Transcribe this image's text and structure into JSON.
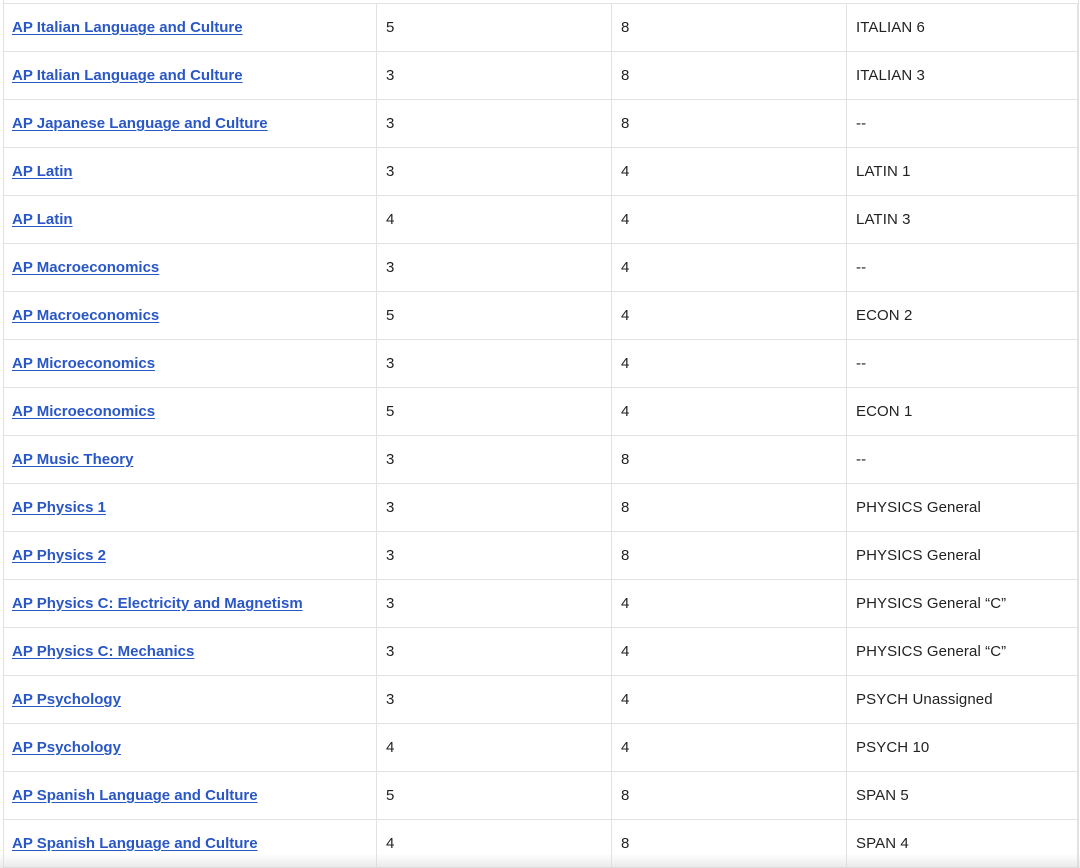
{
  "table": {
    "rows": [
      {
        "exam": "AP Italian Language and Culture",
        "score": "5",
        "units": "8",
        "equivalent": "ITALIAN 6"
      },
      {
        "exam": "AP Italian Language and Culture",
        "score": "3",
        "units": "8",
        "equivalent": "ITALIAN 3"
      },
      {
        "exam": "AP Japanese Language and Culture",
        "score": "3",
        "units": "8",
        "equivalent": "--"
      },
      {
        "exam": "AP Latin",
        "score": "3",
        "units": "4",
        "equivalent": "LATIN 1"
      },
      {
        "exam": "AP Latin",
        "score": "4",
        "units": "4",
        "equivalent": "LATIN 3"
      },
      {
        "exam": "AP Macroeconomics",
        "score": "3",
        "units": "4",
        "equivalent": "--"
      },
      {
        "exam": "AP Macroeconomics",
        "score": "5",
        "units": "4",
        "equivalent": "ECON 2"
      },
      {
        "exam": "AP Microeconomics",
        "score": "3",
        "units": "4",
        "equivalent": "--"
      },
      {
        "exam": "AP Microeconomics",
        "score": "5",
        "units": "4",
        "equivalent": "ECON 1"
      },
      {
        "exam": "AP Music Theory",
        "score": "3",
        "units": "8",
        "equivalent": "--"
      },
      {
        "exam": "AP Physics 1",
        "score": "3",
        "units": "8",
        "equivalent": "PHYSICS General"
      },
      {
        "exam": "AP Physics 2",
        "score": "3",
        "units": "8",
        "equivalent": "PHYSICS General"
      },
      {
        "exam": "AP Physics C: Electricity and Magnetism",
        "score": "3",
        "units": "4",
        "equivalent": "PHYSICS General “C”"
      },
      {
        "exam": "AP Physics C: Mechanics",
        "score": "3",
        "units": "4",
        "equivalent": "PHYSICS General “C”"
      },
      {
        "exam": "AP Psychology",
        "score": "3",
        "units": "4",
        "equivalent": "PSYCH Unassigned"
      },
      {
        "exam": "AP Psychology",
        "score": "4",
        "units": "4",
        "equivalent": "PSYCH 10"
      },
      {
        "exam": "AP Spanish Language and Culture",
        "score": "5",
        "units": "8",
        "equivalent": "SPAN 5"
      },
      {
        "exam": "AP Spanish Language and Culture",
        "score": "4",
        "units": "8",
        "equivalent": "SPAN 4"
      }
    ]
  },
  "colors": {
    "link": "#2a57c6",
    "border": "#e2e2e2",
    "text": "#222222"
  }
}
